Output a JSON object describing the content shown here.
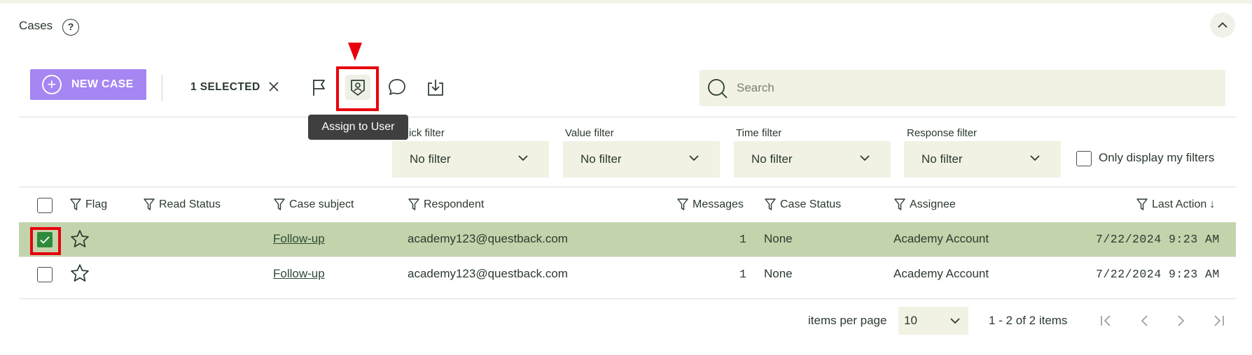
{
  "header": {
    "title": "Cases",
    "help_icon": "?"
  },
  "toolbar": {
    "new_case_label": "NEW CASE",
    "selected_label": "1 SELECTED",
    "tooltip": "Assign to User",
    "search_placeholder": "Search"
  },
  "filters": [
    {
      "label": "Quick filter",
      "value": "No filter"
    },
    {
      "label": "Value filter",
      "value": "No filter"
    },
    {
      "label": "Time filter",
      "value": "No filter"
    },
    {
      "label": "Response filter",
      "value": "No filter"
    }
  ],
  "only_my_filters_label": "Only display my filters",
  "table": {
    "columns": [
      "Flag",
      "Read Status",
      "Case subject",
      "Respondent",
      "Messages",
      "Case Status",
      "Assignee",
      "Last Action"
    ],
    "sort_indicator": "↓",
    "rows": [
      {
        "selected": true,
        "subject": "Follow-up",
        "respondent": "academy123@questback.com",
        "messages": "1",
        "status": "None",
        "assignee": "Academy Account",
        "last_action": "7/22/2024 9:23 AM"
      },
      {
        "selected": false,
        "subject": "Follow-up",
        "respondent": "academy123@questback.com",
        "messages": "1",
        "status": "None",
        "assignee": "Academy Account",
        "last_action": "7/22/2024 9:23 AM"
      }
    ]
  },
  "pagination": {
    "items_per_page_label": "items per page",
    "items_per_page_value": "10",
    "range_text": "1 - 2 of 2 items"
  },
  "colors": {
    "accent": "#a586f2",
    "selected_row": "#c3d4ac",
    "highlight": "#e8000b"
  }
}
